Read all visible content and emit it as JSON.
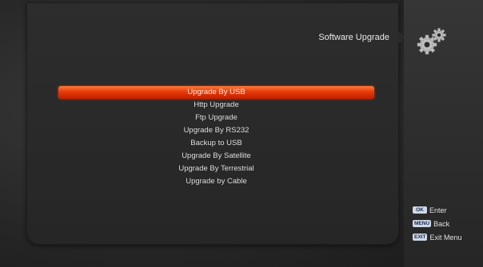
{
  "title": "Software Upgrade",
  "menu": {
    "items": [
      {
        "label": "Upgrade By USB"
      },
      {
        "label": "Http Upgrade"
      },
      {
        "label": "Ftp Upgrade"
      },
      {
        "label": "Upgrade By RS232"
      },
      {
        "label": "Backup to USB"
      },
      {
        "label": "Upgrade By Satellite"
      },
      {
        "label": "Upgrade By Terrestrial"
      },
      {
        "label": "Upgrade by Cable"
      }
    ],
    "selected_index": 0
  },
  "hints": [
    {
      "key": "OK",
      "label": "Enter"
    },
    {
      "key": "MENU",
      "label": "Back"
    },
    {
      "key": "EXIT",
      "label": "Exit Menu"
    }
  ],
  "colors": {
    "highlight": "#e63a0a",
    "text": "#dcdcdc",
    "panel": "#2a2a2a"
  },
  "icons": [
    "gears-icon"
  ]
}
